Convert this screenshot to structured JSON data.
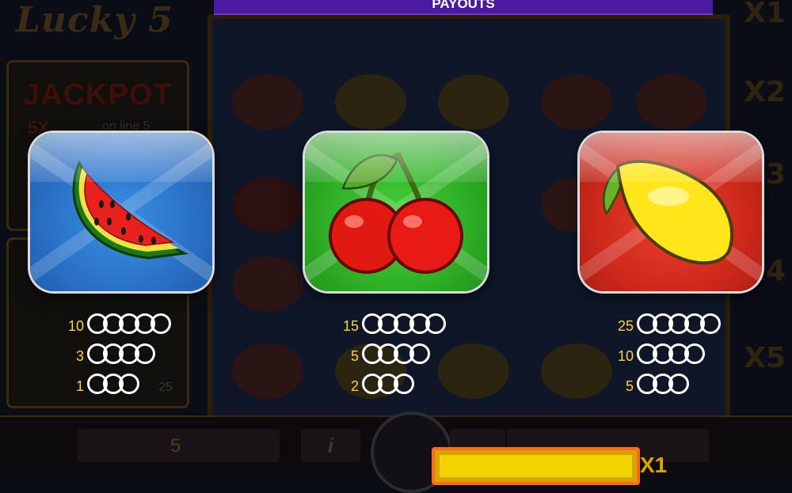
{
  "header": {
    "title": "PAYOUTS"
  },
  "background": {
    "logo_text": "Lucky 5",
    "jackpot": {
      "title": "JACKPOT",
      "multiplier": "5X",
      "line_text": "on line 5"
    },
    "mini_value": "25",
    "lines_value": "5",
    "info_label": "i",
    "multipliers": [
      "X1",
      "X2",
      "X3",
      "X4",
      "X5"
    ],
    "win_multiplier": "X1"
  },
  "symbols": [
    {
      "name": "watermelon",
      "tile_color": "#2a72c8",
      "payouts": [
        {
          "value": "10",
          "coins": 5
        },
        {
          "value": "3",
          "coins": 4
        },
        {
          "value": "1",
          "coins": 3
        }
      ]
    },
    {
      "name": "cherry",
      "tile_color": "#2fb026",
      "payouts": [
        {
          "value": "15",
          "coins": 5
        },
        {
          "value": "5",
          "coins": 4
        },
        {
          "value": "2",
          "coins": 3
        }
      ]
    },
    {
      "name": "lemon",
      "tile_color": "#d02a1c",
      "payouts": [
        {
          "value": "25",
          "coins": 5
        },
        {
          "value": "10",
          "coins": 4
        },
        {
          "value": "5",
          "coins": 3
        }
      ]
    }
  ],
  "colors": {
    "header": "#4a1aa0",
    "payout_value": "#ffd23a",
    "coin_outline": "#ffffff"
  }
}
